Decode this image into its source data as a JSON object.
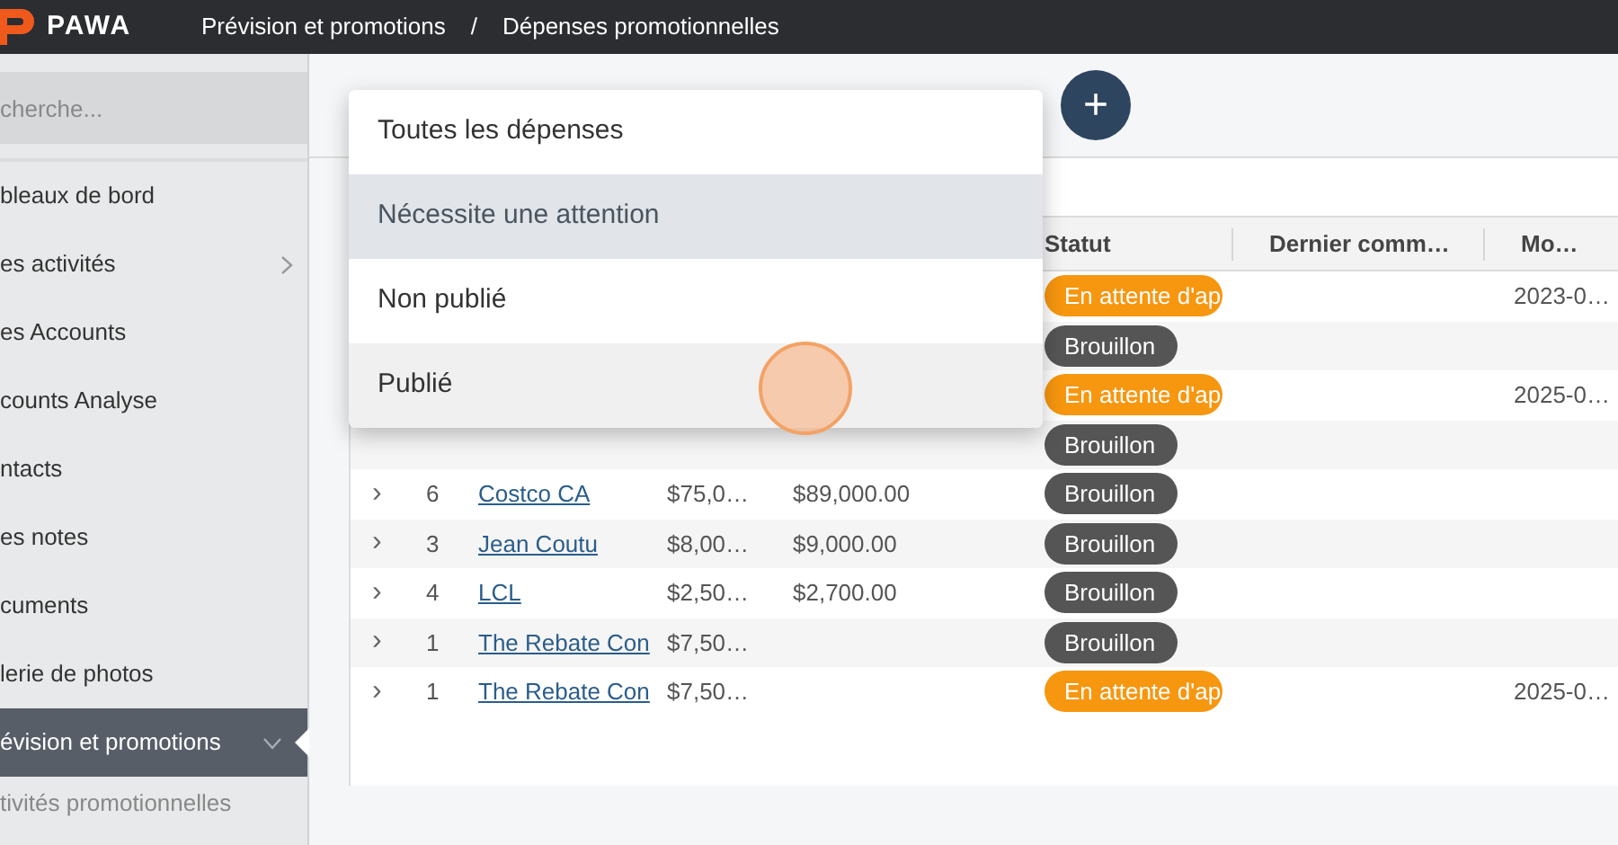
{
  "topbar": {
    "logo": "PAWA",
    "breadcrumb": [
      "Prévision et promotions",
      "Dépenses promotionnelles"
    ],
    "separator": "/"
  },
  "sidebar": {
    "search": {
      "placeholder": "cherche..."
    },
    "items": [
      {
        "label": "bleaux de bord",
        "selected": false,
        "kind": "plain"
      },
      {
        "label": "es activités",
        "selected": false,
        "kind": "collapsed"
      },
      {
        "label": "es Accounts",
        "selected": false,
        "kind": "plain"
      },
      {
        "label": "counts Analyse",
        "selected": false,
        "kind": "plain"
      },
      {
        "label": "ntacts",
        "selected": false,
        "kind": "plain"
      },
      {
        "label": "es notes",
        "selected": false,
        "kind": "plain"
      },
      {
        "label": "cuments",
        "selected": false,
        "kind": "plain"
      },
      {
        "label": "lerie de photos",
        "selected": false,
        "kind": "plain"
      },
      {
        "label": "évision et promotions",
        "selected": true,
        "kind": "expanded",
        "children": [
          {
            "label": "tivités promotionnelles",
            "selected": false
          }
        ]
      }
    ]
  },
  "add_button": "+",
  "filter_menu": [
    {
      "label": "Toutes les dépenses",
      "selected": false,
      "hovered": false
    },
    {
      "label": "Nécessite une attention",
      "selected": true,
      "hovered": false
    },
    {
      "label": "Non publié",
      "selected": false,
      "hovered": false
    },
    {
      "label": "Publié",
      "selected": false,
      "hovered": true
    }
  ],
  "table": {
    "columns": [
      "Statut",
      "Dernier comm…",
      "Mo…"
    ],
    "rows": [
      {
        "status": {
          "label": "En attente d'ap",
          "kind": "pending"
        },
        "date": "2023-0…"
      },
      {
        "status": {
          "label": "Brouillon",
          "kind": "draft"
        }
      },
      {
        "status": {
          "label": "En attente d'ap",
          "kind": "pending"
        },
        "date": "2025-0…"
      },
      {
        "status": {
          "label": "Brouillon",
          "kind": "draft"
        }
      },
      {
        "expander": "›",
        "count": "6",
        "name": "Costco CA",
        "amount": "$75,0…",
        "total": "$89,000.00",
        "status": {
          "label": "Brouillon",
          "kind": "draft"
        }
      },
      {
        "expander": "›",
        "count": "3",
        "name": "Jean Coutu",
        "amount": "$8,00…",
        "total": "$9,000.00",
        "status": {
          "label": "Brouillon",
          "kind": "draft"
        }
      },
      {
        "expander": "›",
        "count": "4",
        "name": "LCL",
        "amount": "$2,50…",
        "total": "$2,700.00",
        "status": {
          "label": "Brouillon",
          "kind": "draft"
        }
      },
      {
        "expander": "›",
        "count": "1",
        "name": "The Rebate Con",
        "amount": "$7,50…",
        "status": {
          "label": "Brouillon",
          "kind": "draft"
        }
      },
      {
        "expander": "›",
        "count": "1",
        "name": "The Rebate Con",
        "amount": "$7,50…",
        "status": {
          "label": "En attente d'ap",
          "kind": "pending"
        },
        "date": "2025-0…"
      }
    ]
  }
}
